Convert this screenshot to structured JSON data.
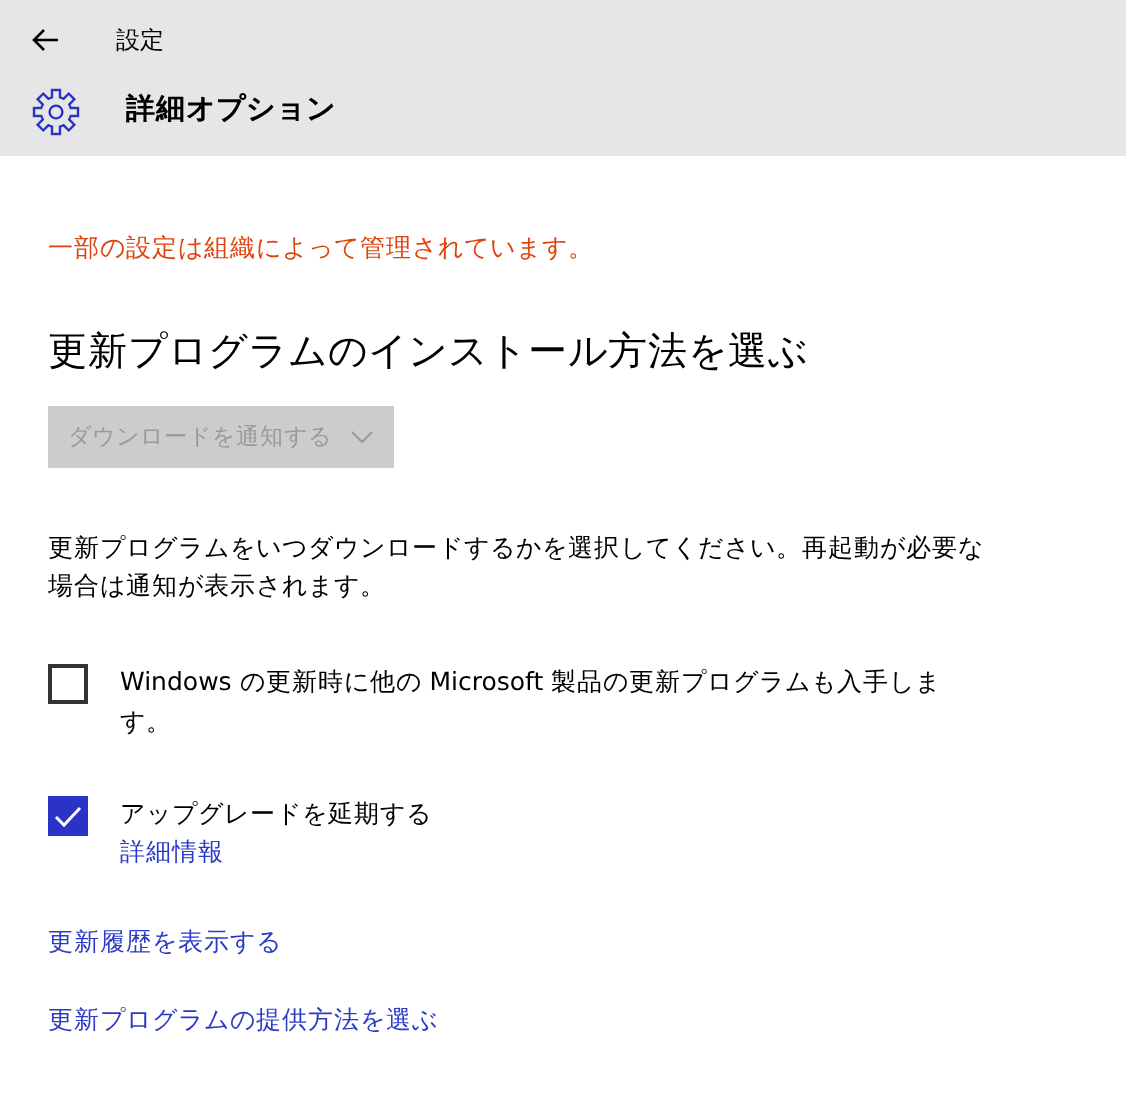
{
  "window": {
    "title": "設定"
  },
  "page": {
    "title": "詳細オプション"
  },
  "notice": "一部の設定は組織によって管理されています。",
  "heading": "更新プログラムのインストール方法を選ぶ",
  "dropdown": {
    "value": "ダウンロードを通知する",
    "disabled": true
  },
  "description": "更新プログラムをいつダウンロードするかを選択してください。再起動が必要な場合は通知が表示されます。",
  "options": [
    {
      "label": "Windows の更新時に他の Microsoft 製品の更新プログラムも入手します。",
      "checked": false
    },
    {
      "label": "アップグレードを延期する",
      "checked": true,
      "link": "詳細情報"
    }
  ],
  "links": [
    "更新履歴を表示する",
    "更新プログラムの提供方法を選ぶ"
  ]
}
